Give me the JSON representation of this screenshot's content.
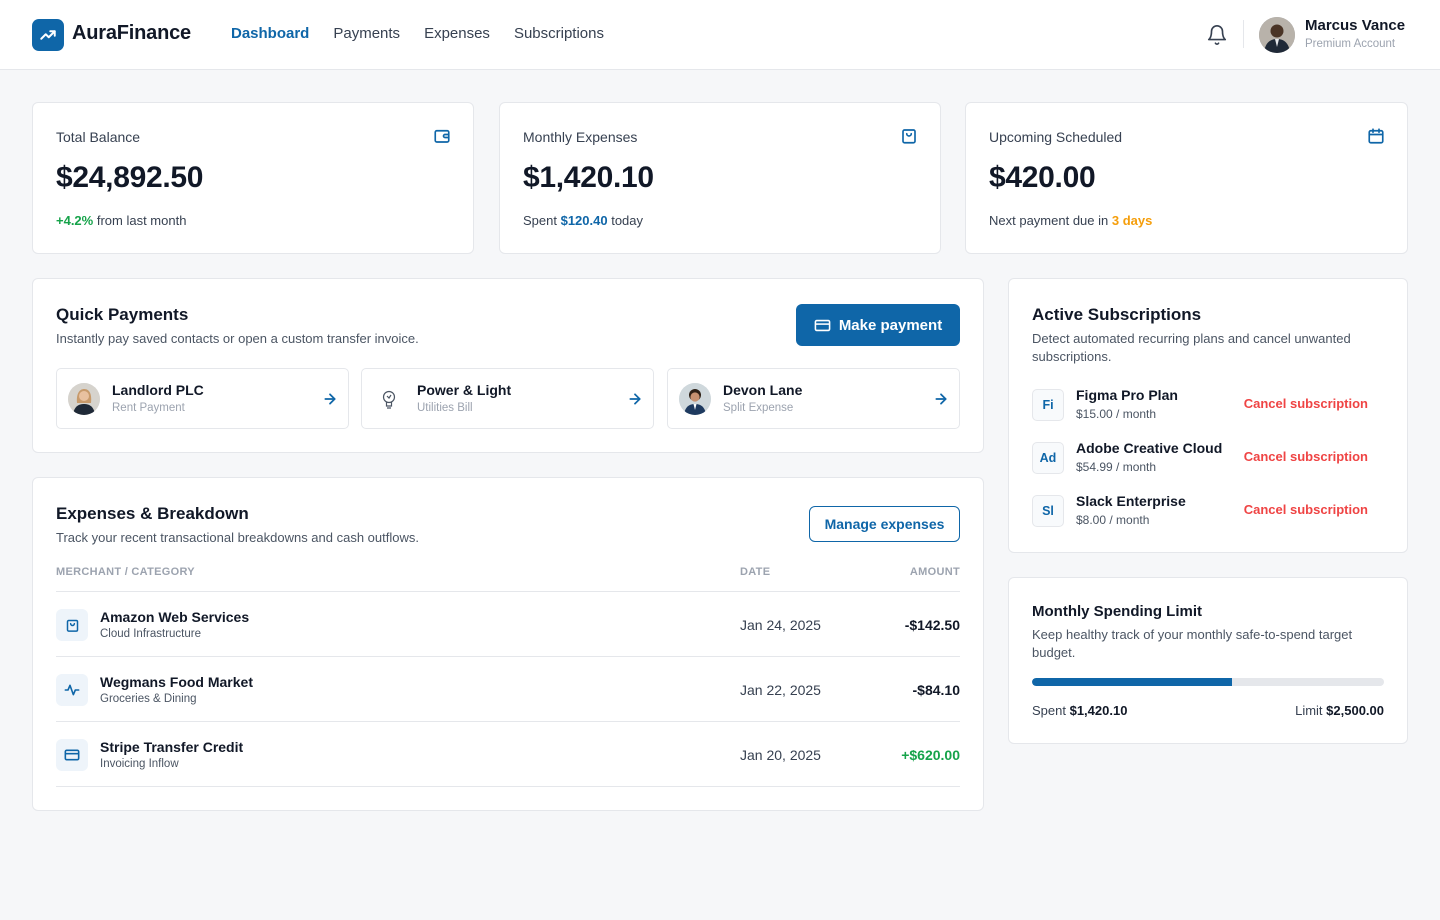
{
  "header": {
    "brand": "AuraFinance",
    "nav": [
      "Dashboard",
      "Payments",
      "Expenses",
      "Subscriptions"
    ],
    "user_name": "Marcus Vance",
    "user_plan": "Premium Account"
  },
  "stats": {
    "balance": {
      "label": "Total Balance",
      "value": "$24,892.50",
      "change": "+4.2%",
      "note": " from last month"
    },
    "expenses": {
      "label": "Monthly Expenses",
      "value": "$1,420.10",
      "note_pre": "Spent ",
      "highlight": "$120.40",
      "note_post": " today"
    },
    "scheduled": {
      "label": "Upcoming Scheduled",
      "value": "$420.00",
      "note_pre": "Next payment due in ",
      "highlight": "3 days"
    }
  },
  "quick_payments": {
    "title": "Quick Payments",
    "desc": "Instantly pay saved contacts or open a custom transfer invoice.",
    "button": "Make payment",
    "contacts": [
      {
        "name": "Landlord PLC",
        "sub": "Rent Payment"
      },
      {
        "name": "Power & Light",
        "sub": "Utilities Bill"
      },
      {
        "name": "Devon Lane",
        "sub": "Split Expense"
      }
    ]
  },
  "expenses": {
    "title": "Expenses & Breakdown",
    "desc": "Track your recent transactional breakdowns and cash outflows.",
    "button": "Manage expenses",
    "columns": [
      "MERCHANT / CATEGORY",
      "DATE",
      "AMOUNT"
    ],
    "rows": [
      {
        "name": "Amazon Web Services",
        "category": "Cloud Infrastructure",
        "date": "Jan 24, 2025",
        "amount": "-$142.50",
        "icon": "shopping-bag-icon"
      },
      {
        "name": "Wegmans Food Market",
        "category": "Groceries & Dining",
        "date": "Jan 22, 2025",
        "amount": "-$84.10",
        "icon": "activity-icon"
      },
      {
        "name": "Stripe Transfer Credit",
        "category": "Invoicing Inflow",
        "date": "Jan 20, 2025",
        "amount": "+$620.00",
        "icon": "credit-card-icon"
      }
    ]
  },
  "subscriptions": {
    "title": "Active Subscriptions",
    "desc": "Detect automated recurring plans and cancel unwanted subscriptions.",
    "items": [
      {
        "badge": "Fi",
        "name": "Figma Pro Plan",
        "price": "$15.00 / month",
        "action": "Cancel subscription"
      },
      {
        "badge": "Ad",
        "name": "Adobe Creative Cloud",
        "price": "$54.99 / month",
        "action": "Cancel subscription"
      },
      {
        "badge": "Sl",
        "name": "Slack Enterprise",
        "price": "$8.00 / month",
        "action": "Cancel subscription"
      }
    ]
  },
  "limit": {
    "title": "Monthly Spending Limit",
    "desc": "Keep healthy track of your monthly safe-to-spend target budget.",
    "spent_label": "Spent ",
    "spent": "$1,420.10",
    "limit_label": "Limit ",
    "limit": "$2,500.00",
    "progress": 0.568
  },
  "colors": {
    "accent": "#0f66a8",
    "positive": "#16a34a",
    "warning": "#f59e0b",
    "danger": "#ef4444"
  }
}
